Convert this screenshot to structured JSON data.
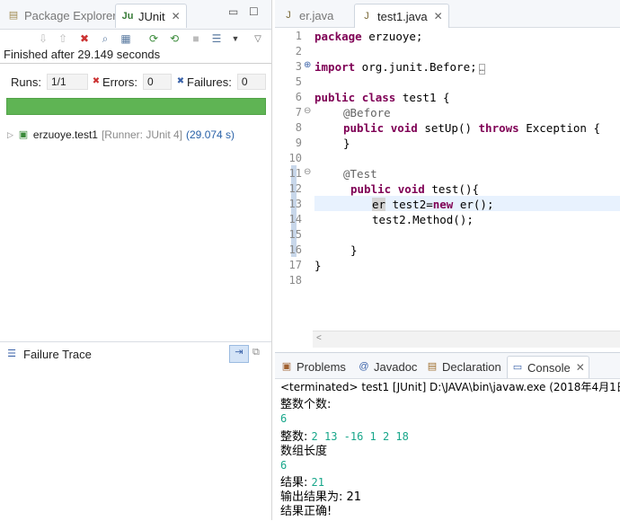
{
  "left": {
    "tabs": [
      {
        "label": "Package Explorer",
        "icon": "package-icon"
      },
      {
        "label": "JUnit",
        "icon": "junit-icon",
        "close": "✕"
      }
    ],
    "status": "Finished after 29.149 seconds",
    "runs_label": "Runs:",
    "runs_value": "1/1",
    "errors_label": "Errors:",
    "errors_value": "0",
    "failures_label": "Failures:",
    "failures_value": "0",
    "progress": 1.0,
    "progress_color": "#5fb454",
    "tree": {
      "name": "erzuoye.test1",
      "runner": "[Runner: JUnit 4]",
      "time": "(29.074 s)"
    },
    "trace_label": "Failure Trace"
  },
  "editor": {
    "tabs": [
      {
        "label": "er.java"
      },
      {
        "label": "test1.java",
        "close": "✕"
      }
    ],
    "lines": [
      "1",
      "2",
      "3",
      "5",
      "6",
      "7",
      "8",
      "9",
      "10",
      "11",
      "12",
      "13",
      "14",
      "15",
      "16",
      "17",
      "18"
    ],
    "code": {
      "l1_kw": "package",
      "l1_rest": " erzuoye;",
      "l3_kw": "import",
      "l3_rest": " org.junit.Before;",
      "l6_kw1": "public",
      "l6_kw2": "class",
      "l6_rest": " test1 {",
      "l7": "@Before",
      "l8_kw1": "public",
      "l8_kw2": "void",
      "l8_mid": " setUp() ",
      "l8_kw3": "throws",
      "l8_rest": " Exception {",
      "l9": "}",
      "l11": "@Test",
      "l12_kw1": "public",
      "l12_kw2": "void",
      "l12_rest": " test(){",
      "l13_a": "er",
      "l13_b": " test2=",
      "l13_kw": "new",
      "l13_c": " er();",
      "l14": "test2.Method();",
      "l16": "}",
      "l17": "}"
    }
  },
  "console": {
    "tabs": [
      {
        "label": "Problems",
        "icon": "problems-icon"
      },
      {
        "label": "Javadoc",
        "icon": "javadoc-icon"
      },
      {
        "label": "Declaration",
        "icon": "declaration-icon"
      },
      {
        "label": "Console",
        "icon": "console-icon",
        "close": "✕"
      }
    ],
    "header": "<terminated> test1 [JUnit] D:\\JAVA\\bin\\javaw.exe (2018年4月1日 下",
    "lines": [
      {
        "text": "整数个数:",
        "style": "black"
      },
      {
        "text": "6",
        "style": "green"
      },
      {
        "text": "整数: ",
        "style": "black",
        "tail": "2 13 -16 1 2 18"
      },
      {
        "text": "数组长度",
        "style": "black"
      },
      {
        "text": "6",
        "style": "green"
      },
      {
        "text": "结果: ",
        "style": "black",
        "tail": "21"
      },
      {
        "text": "输出结果为: 21",
        "style": "black"
      },
      {
        "text": "结果正确!",
        "style": "black"
      }
    ]
  }
}
